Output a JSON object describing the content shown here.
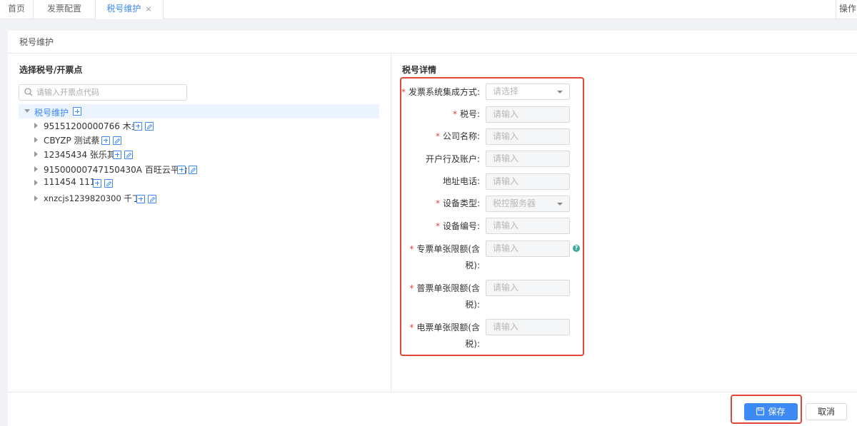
{
  "tabs": [
    {
      "label": "首页",
      "active": false
    },
    {
      "label": "发票配置",
      "active": false
    },
    {
      "label": "税号维护",
      "active": true,
      "closable": true,
      "close_glyph": "×"
    }
  ],
  "operations_label": "操作",
  "panel": {
    "title": "税号维护"
  },
  "left": {
    "title": "选择税号/开票点",
    "search_placeholder": "请输入开票点代码",
    "root_label": "税号维护",
    "items": [
      {
        "label": "95151200000766 木头"
      },
      {
        "label": "CBYZP 测试蔡"
      },
      {
        "label": "12345434 张乐其"
      },
      {
        "label": "91500000747150430A 百旺云平台"
      },
      {
        "label": "111454 111"
      },
      {
        "label": "xnzcjs1239820300 千丁"
      }
    ]
  },
  "right": {
    "title": "税号详情",
    "required_mark": "*",
    "fields": [
      {
        "label": "发票系统集成方式:",
        "required": true,
        "placeholder": "请选择",
        "type": "select"
      },
      {
        "label": "税号:",
        "required": true,
        "placeholder": "请输入",
        "type": "input"
      },
      {
        "label": "公司名称:",
        "required": true,
        "placeholder": "请输入",
        "type": "input"
      },
      {
        "label": "开户行及账户:",
        "required": false,
        "placeholder": "请输入",
        "type": "input"
      },
      {
        "label": "地址电话:",
        "required": false,
        "placeholder": "请输入",
        "type": "input"
      },
      {
        "label": "设备类型:",
        "required": true,
        "placeholder": "税控服务器",
        "type": "select"
      },
      {
        "label": "设备编号:",
        "required": true,
        "placeholder": "请输入",
        "type": "input"
      },
      {
        "label_line1": "专票单张限额(含",
        "label_line2": "税):",
        "required": true,
        "placeholder": "请输入",
        "type": "input",
        "help": "?"
      },
      {
        "label_line1": "普票单张限额(含",
        "label_line2": "税):",
        "required": true,
        "placeholder": "请输入",
        "type": "input"
      },
      {
        "label_line1": "电票单张限额(含",
        "label_line2": "税):",
        "required": true,
        "placeholder": "请输入",
        "type": "input"
      }
    ]
  },
  "buttons": {
    "save": "保存",
    "cancel": "取消"
  },
  "colors": {
    "accent": "#3d8af5",
    "highlight_border": "#e0463a",
    "help": "#3fa79e"
  },
  "icons": [
    "search-icon",
    "plus-icon",
    "edit-icon",
    "save-icon",
    "help-icon",
    "close-icon",
    "caret-right-icon",
    "caret-down-icon",
    "dropdown-arrow-icon"
  ]
}
